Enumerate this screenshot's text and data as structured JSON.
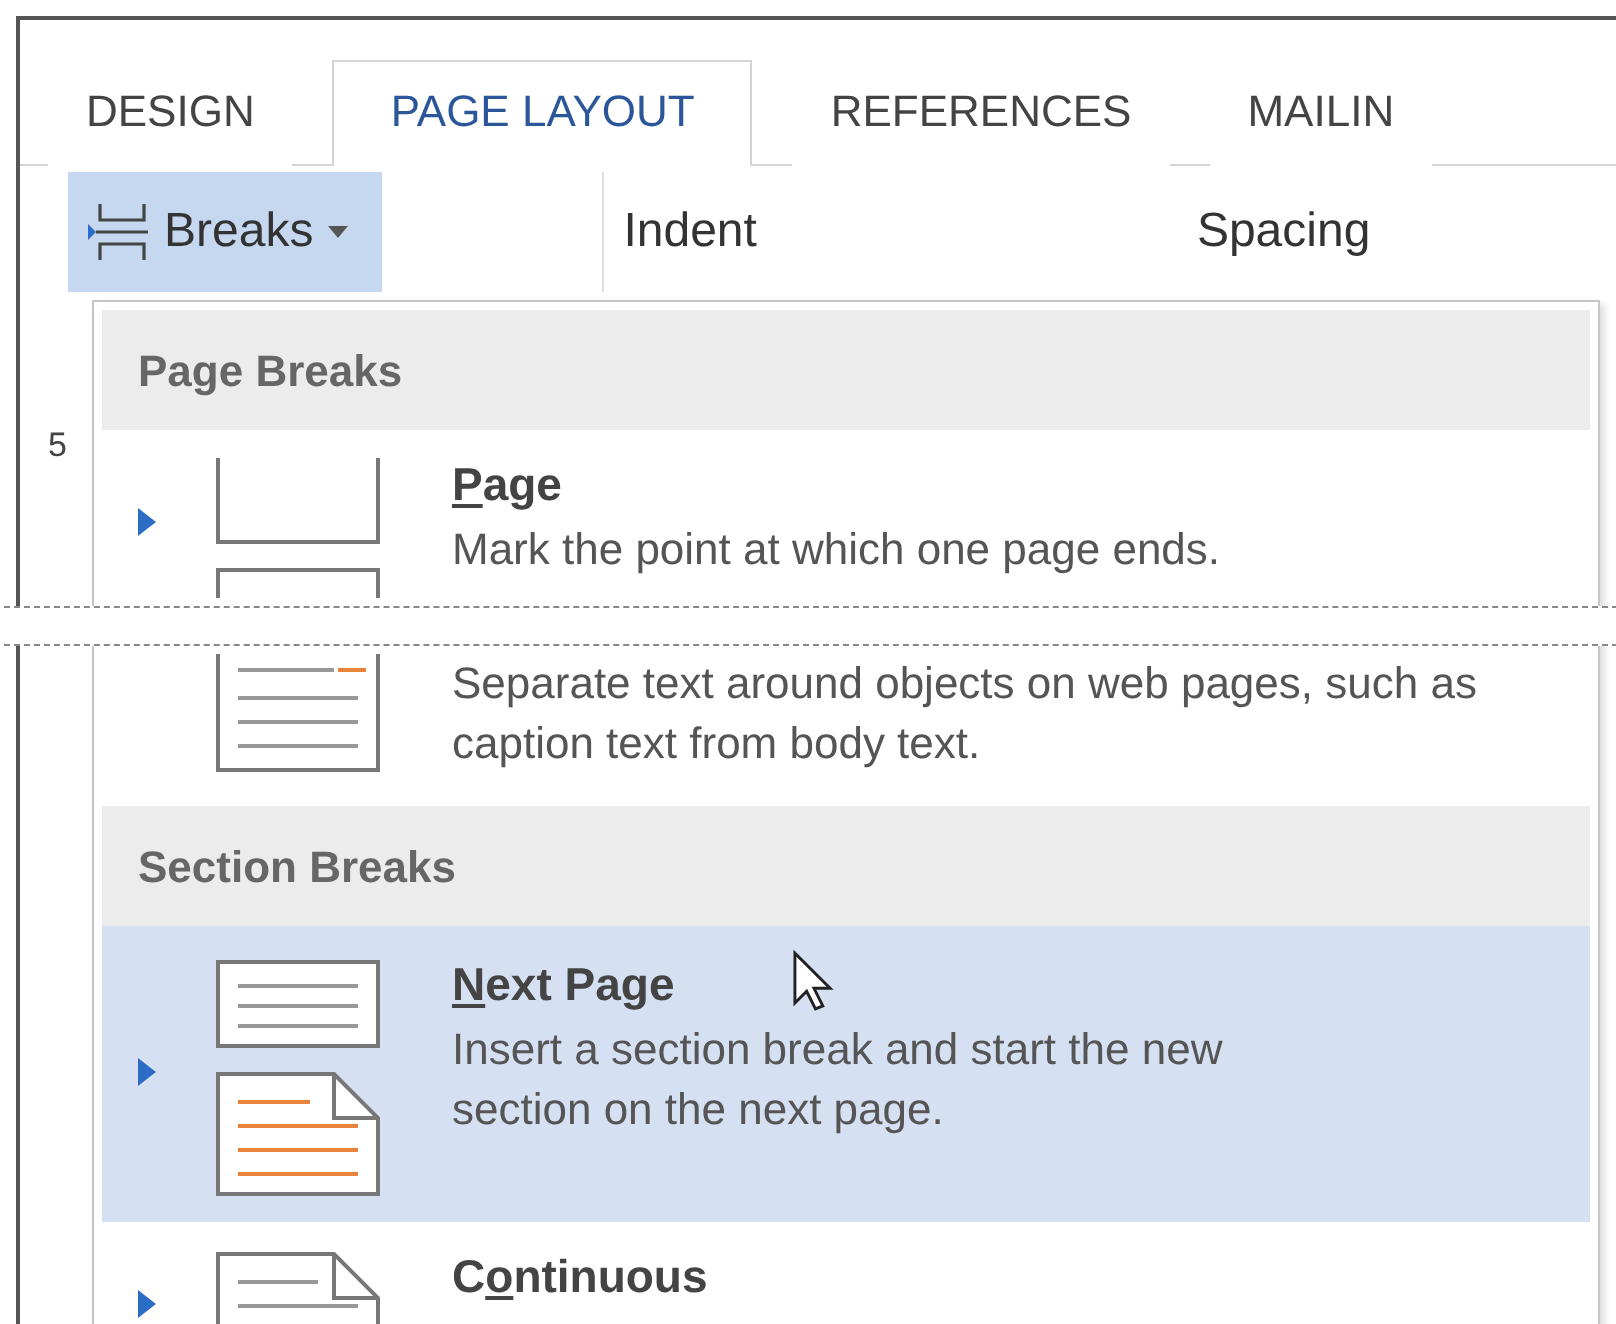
{
  "tabs": [
    {
      "label": "DESIGN",
      "selected": false
    },
    {
      "label": "PAGE LAYOUT",
      "selected": true
    },
    {
      "label": "REFERENCES",
      "selected": false
    },
    {
      "label": "MAILIN",
      "selected": false
    }
  ],
  "ribbon": {
    "breaks_button": {
      "label": "Breaks",
      "pressed": true
    },
    "groups": [
      "Indent",
      "Spacing"
    ],
    "side_text": "5"
  },
  "menu": {
    "sections": [
      {
        "header": "Page Breaks",
        "items": [
          {
            "kind": "page",
            "title_key": "P",
            "title_post": "age",
            "description": "Mark the point at which one page ends.",
            "selected": false
          },
          {
            "kind": "tear"
          },
          {
            "kind": "wrapping",
            "description": "Separate text around objects on web pages, such as caption text from body text.",
            "selected": false
          }
        ]
      },
      {
        "header": "Section Breaks",
        "items": [
          {
            "kind": "next-page",
            "title_key": "N",
            "title_post": "ext Page",
            "description": "Insert a section break and start the new section on the next page.",
            "selected": true,
            "pointer": true
          },
          {
            "kind": "continuous",
            "title_pre": "C",
            "title_key": "o",
            "title_post": "ntinuous",
            "selected": false
          }
        ]
      }
    ]
  }
}
